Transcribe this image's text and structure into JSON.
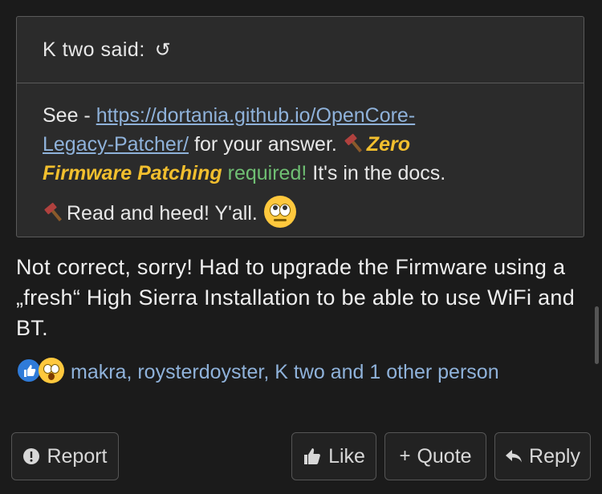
{
  "quote": {
    "author_label": "K two said:",
    "text_see": "See - ",
    "link": "https://dortania.github.io/OpenCore-Legacy-Patcher/",
    "link_line1": "https://dortania.github.io/OpenCore-",
    "link_line2": "Legacy-Patcher/",
    "text_after_link": " for your answer. ",
    "zero_patching": "Zero Firmware Patching",
    "zero_line1": "Zero",
    "zero_line2": "Firmware Patching",
    "required": " required!",
    "docs": " It's in the docs.",
    "read_heed": "Read and heed! Y'all."
  },
  "message": {
    "text": "Not correct, sorry! Had to upgrade the Firmware using a „fresh“ High Sierra Installation to be able to use WiFi and BT."
  },
  "reactions": {
    "users": "makra, roysterdoyster, K two and 1 other person"
  },
  "actions": {
    "report": "Report",
    "like": "Like",
    "quote": "Quote",
    "reply": "Reply"
  },
  "icons": {
    "quote_back": "return-arrow-icon",
    "hammer": "hammer-icon",
    "eyes": "rolling-eyes-emoji-icon",
    "like_reaction": "thumbs-up-reaction-icon",
    "wow_reaction": "astonished-reaction-icon",
    "report": "exclamation-circle-icon",
    "like": "thumbs-up-icon",
    "quote": "plus-icon",
    "reply": "reply-arrow-icon"
  },
  "colors": {
    "link": "#8fb2da",
    "zero": "#f2bf2e",
    "required": "#6fbf73",
    "like_reaction": "#2f7bd9"
  }
}
